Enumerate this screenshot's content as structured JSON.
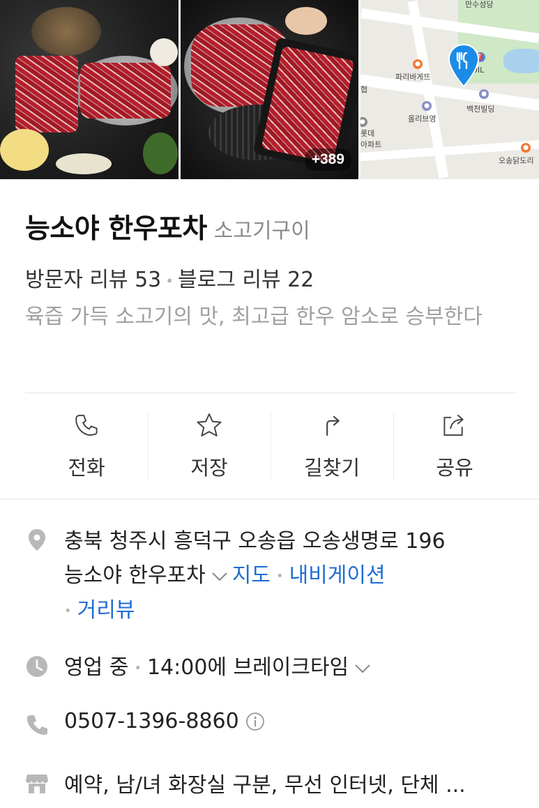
{
  "photos": {
    "more_count": "+389",
    "map_labels": {
      "church": "만수성당",
      "paris": "파리바게뜨",
      "soil": "S-OIL",
      "hyeop": "협",
      "oliveyoung": "올리브영",
      "baekcheon": "백천빌딩",
      "lotte": "롯데",
      "apt": "아파트",
      "chicken": "오송닭도리"
    }
  },
  "place": {
    "name": "능소야 한우포차",
    "category": "소고기구이",
    "visitor_reviews": "방문자 리뷰 53",
    "blog_reviews": "블로그 리뷰 22",
    "description": "육즙 가득 소고기의 맛, 최고급 한우 암소로 승부한다"
  },
  "actions": {
    "call": "전화",
    "save": "저장",
    "directions": "길찾기",
    "share": "공유"
  },
  "info": {
    "address_line1": "충북 청주시 흥덕구 오송읍 오송생명로 196",
    "address_line2": "능소야 한우포차",
    "map_link": "지도",
    "navi_link": "내비게이션",
    "streetview_link": "거리뷰",
    "status": "영업 중",
    "break_time": "14:00에 브레이크타임",
    "phone": "0507-1396-8860",
    "facilities": "예약, 남/녀 화장실 구분, 무선 인터넷, 단체 ..."
  },
  "colors": {
    "link": "#1f6ed4",
    "pin": "#1a8ce8",
    "muted": "#a0a0a0"
  }
}
